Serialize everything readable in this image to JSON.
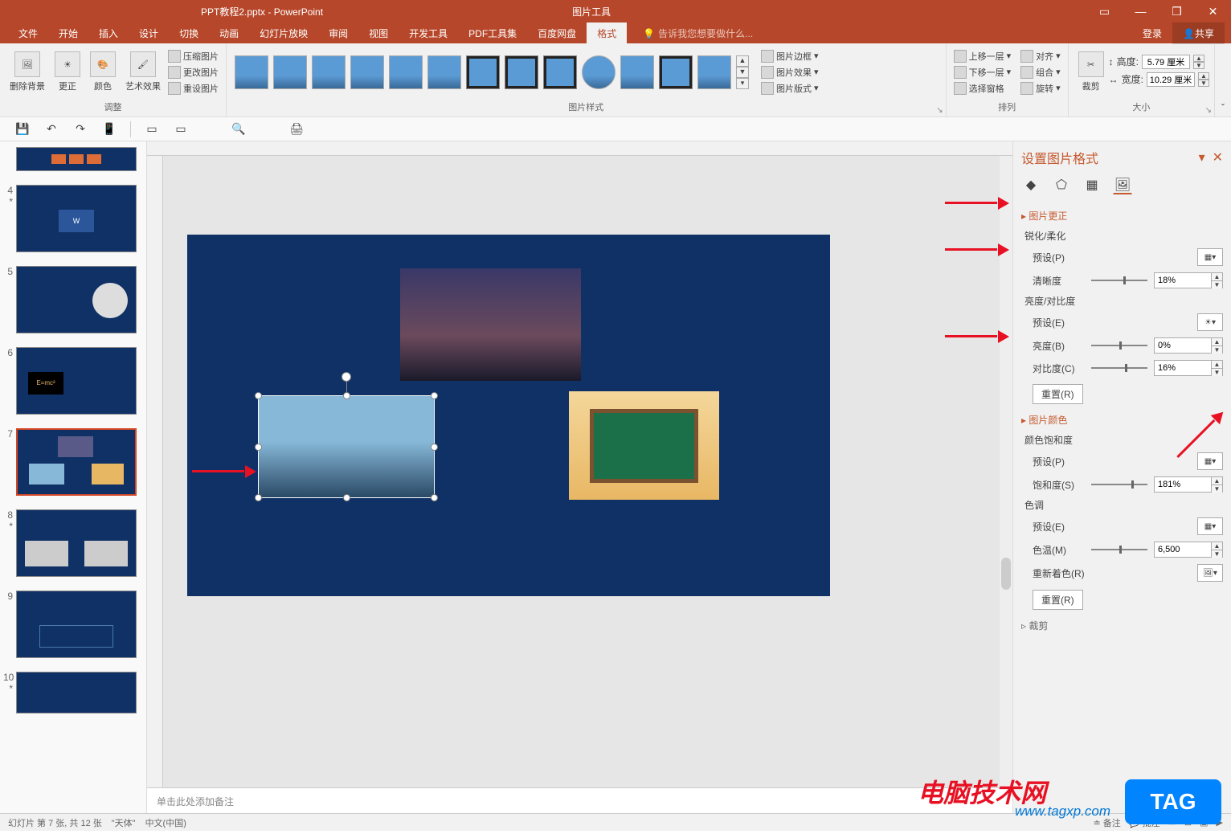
{
  "title": {
    "filename": "PPT教程2.pptx - PowerPoint",
    "contextTab": "图片工具"
  },
  "winControls": {
    "restore": "❐",
    "minimize": "—",
    "close": "✕",
    "ribbonOpts": "▭"
  },
  "tabs": {
    "file": "文件",
    "home": "开始",
    "insert": "插入",
    "design": "设计",
    "transitions": "切换",
    "animations": "动画",
    "slideshow": "幻灯片放映",
    "review": "审阅",
    "view": "视图",
    "developer": "开发工具",
    "pdfTools": "PDF工具集",
    "baiduNetdisk": "百度网盘",
    "format": "格式"
  },
  "account": {
    "signin": "登录",
    "share": "共享"
  },
  "tellMe": {
    "placeholder": "告诉我您想要做什么..."
  },
  "ribbon": {
    "removeBg": "删除背景",
    "corrections": "更正",
    "color": "颜色",
    "artistic": "艺术效果",
    "compress": "压缩图片",
    "change": "更改图片",
    "reset": "重设图片",
    "groupAdjust": "调整",
    "border": "图片边框",
    "effects": "图片效果",
    "layout": "图片版式",
    "groupStyles": "图片样式",
    "forward": "上移一层",
    "backward": "下移一层",
    "selection": "选择窗格",
    "align": "对齐",
    "group": "组合",
    "rotate": "旋转",
    "groupArrange": "排列",
    "crop": "裁剪",
    "height": "高度:",
    "heightVal": "5.79 厘米",
    "width": "宽度:",
    "widthVal": "10.29 厘米",
    "groupSize": "大小"
  },
  "qat": {
    "save": "💾",
    "undo": "↶",
    "redo": "↷"
  },
  "thumbs": {
    "slideNums": [
      "4",
      "5",
      "6",
      "7",
      "8",
      "9",
      "10"
    ],
    "star": "*"
  },
  "notesPlaceholder": "单击此处添加备注",
  "formatPane": {
    "title": "设置图片格式",
    "sec1": "图片更正",
    "sharpenSoft": "锐化/柔化",
    "presetP": "预设(P)",
    "sharpness": "清晰度",
    "sharpnessVal": "18%",
    "brightnessContrast": "亮度/对比度",
    "presetE": "预设(E)",
    "brightness": "亮度(B)",
    "brightnessVal": "0%",
    "contrast": "对比度(C)",
    "contrastVal": "16%",
    "resetR": "重置(R)",
    "sec2": "图片颜色",
    "saturationH": "颜色饱和度",
    "saturation": "饱和度(S)",
    "saturationVal": "181%",
    "tone": "色调",
    "colorTemp": "色温(M)",
    "colorTempVal": "6,500",
    "recolor": "重新着色(R)",
    "sec3": "裁剪"
  },
  "status": {
    "slideInfo": "幻灯片 第 7 张, 共 12 张",
    "lang": "\"天体\"",
    "ime": "中文(中国)",
    "notes": "备注",
    "comments": "批注"
  },
  "watermark": {
    "brand": "电脑技术网",
    "tag": "TAG",
    "url": "www.tagxp.com"
  }
}
